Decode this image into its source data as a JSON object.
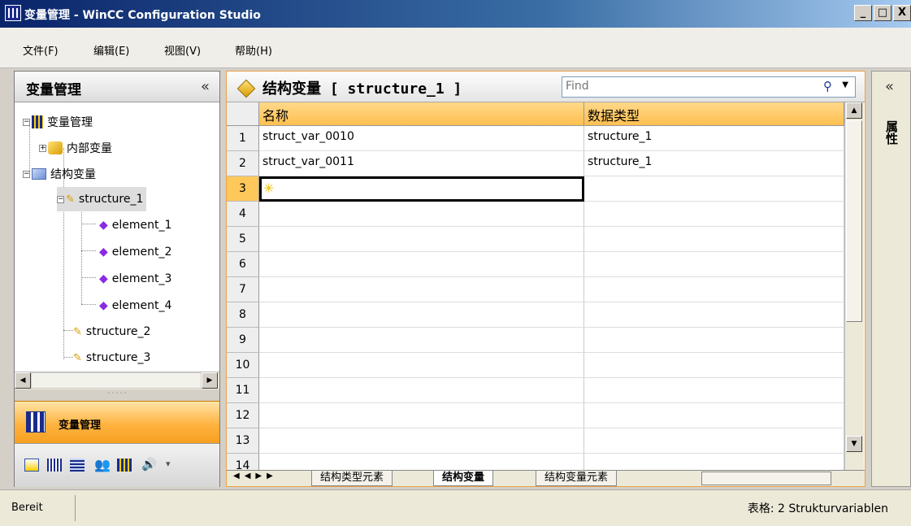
{
  "window": {
    "title": "变量管理 - WinCC Configuration Studio",
    "btn_min": "_",
    "btn_max": "□",
    "btn_close": "X"
  },
  "menu": [
    "文件(F)",
    "编辑(E)",
    "视图(V)",
    "帮助(H)"
  ],
  "left": {
    "title": "变量管理",
    "collapse": "«",
    "tree": [
      {
        "label": "变量管理"
      },
      {
        "label": "内部变量"
      },
      {
        "label": "结构变量"
      },
      {
        "label": "structure_1"
      },
      {
        "label": "element_1"
      },
      {
        "label": "element_2"
      },
      {
        "label": "element_3"
      },
      {
        "label": "element_4"
      },
      {
        "label": "structure_2"
      },
      {
        "label": "structure_3"
      }
    ],
    "nav_button": "变量管理"
  },
  "main": {
    "title": "结构变量 [ structure_1 ]",
    "find_placeholder": "Find",
    "columns": [
      "名称",
      "数据类型"
    ],
    "rows": [
      {
        "num": "1",
        "name": "struct_var_0010",
        "type": "structure_1"
      },
      {
        "num": "2",
        "name": "struct_var_0011",
        "type": "structure_1"
      },
      {
        "num": "3",
        "name": "",
        "type": ""
      },
      {
        "num": "4"
      },
      {
        "num": "5"
      },
      {
        "num": "6"
      },
      {
        "num": "7"
      },
      {
        "num": "8"
      },
      {
        "num": "9"
      },
      {
        "num": "10"
      },
      {
        "num": "11"
      },
      {
        "num": "12"
      },
      {
        "num": "13"
      },
      {
        "num": "14"
      }
    ],
    "tabs": [
      "结构类型元素",
      "结构变量",
      "结构变量元素"
    ],
    "active_tab": "结构变量"
  },
  "right": {
    "collapse": "«",
    "label": "属性"
  },
  "status": {
    "left": "Bereit",
    "right": "表格: 2 Strukturvariablen"
  }
}
